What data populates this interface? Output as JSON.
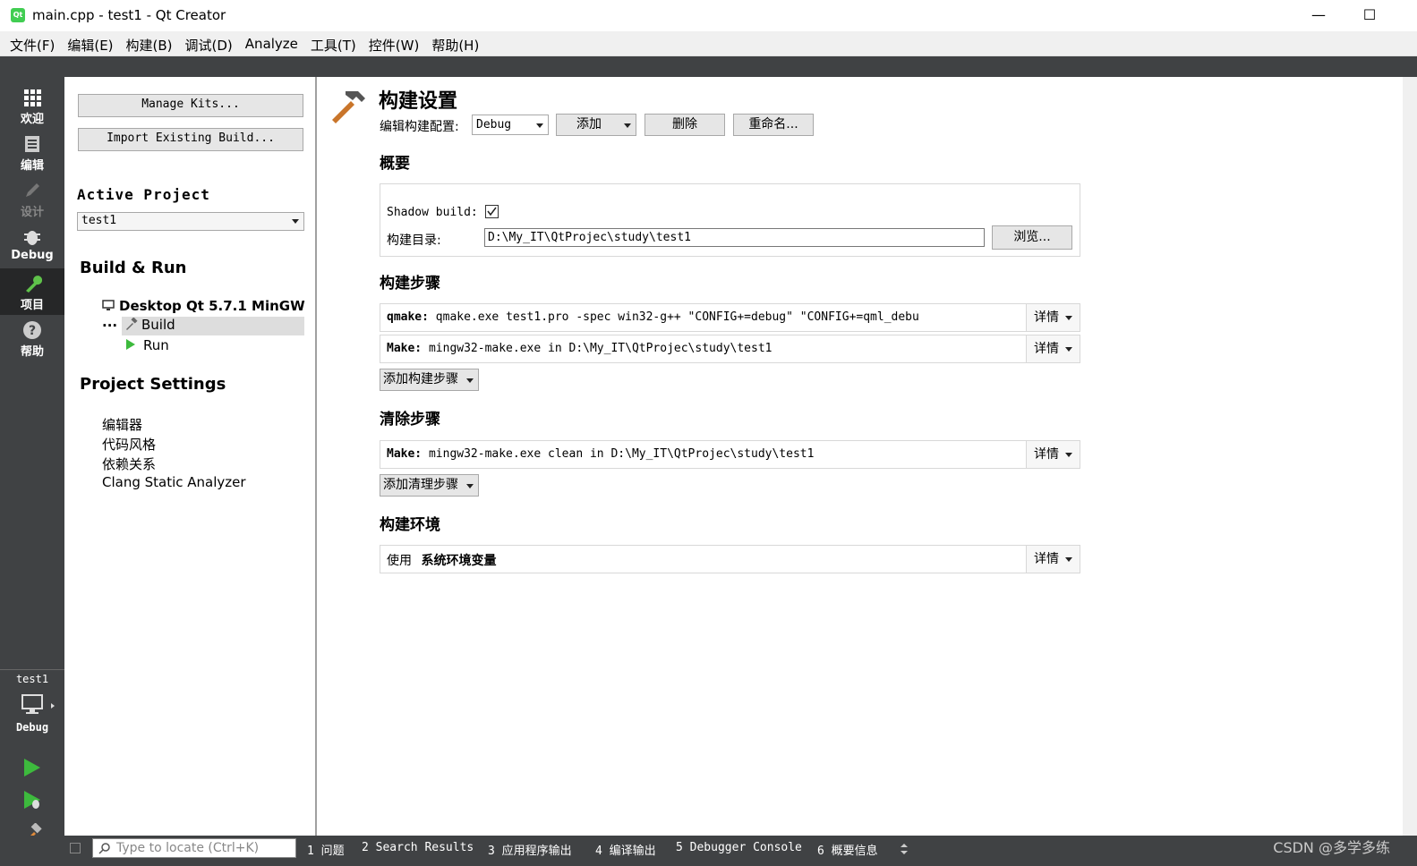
{
  "window": {
    "title": "main.cpp - test1 - Qt Creator",
    "app_icon_text": "Qt",
    "minimize_glyph": "—",
    "maximize_glyph": "☐"
  },
  "menu": [
    "文件(F)",
    "编辑(E)",
    "构建(B)",
    "调试(D)",
    "Analyze",
    "工具(T)",
    "控件(W)",
    "帮助(H)"
  ],
  "modes": {
    "welcome": "欢迎",
    "edit": "编辑",
    "design": "设计",
    "debug": "Debug",
    "projects": "项目",
    "help": "帮助"
  },
  "kit_selector": {
    "project": "test1",
    "config": "Debug"
  },
  "left_panel": {
    "manage_kits": "Manage Kits...",
    "import_build": "Import Existing Build...",
    "active_project_label": "Active Project",
    "active_project_value": "test1",
    "build_run_title": "Build & Run",
    "kit_name": "Desktop Qt 5.7.1 MinGW ...",
    "build_item": "Build",
    "run_item": "Run",
    "project_settings_title": "Project Settings",
    "settings_items": [
      "编辑器",
      "代码风格",
      "依赖关系",
      "Clang Static Analyzer"
    ]
  },
  "main": {
    "page_title": "构建设置",
    "edit_config_label": "编辑构建配置:",
    "config_value": "Debug",
    "add_button": "添加",
    "delete_button": "删除",
    "rename_button": "重命名...",
    "general_title": "概要",
    "shadow_build_label": "Shadow build:",
    "shadow_build_checked": true,
    "build_dir_label": "构建目录:",
    "build_dir_value": "D:\\My_IT\\QtProjec\\study\\test1",
    "browse_button": "浏览...",
    "build_steps_title": "构建步骤",
    "build_steps": [
      {
        "name": "qmake:",
        "cmd": "qmake.exe test1.pro -spec win32-g++ \"CONFIG+=debug\" \"CONFIG+=qml_debu",
        "details": "详情"
      },
      {
        "name": "Make:",
        "cmd": "mingw32-make.exe in D:\\My_IT\\QtProjec\\study\\test1",
        "details": "详情"
      }
    ],
    "add_build_step": "添加构建步骤",
    "clean_steps_title": "清除步骤",
    "clean_steps": [
      {
        "name": "Make:",
        "cmd": "mingw32-make.exe clean in D:\\My_IT\\QtProjec\\study\\test1",
        "details": "详情"
      }
    ],
    "add_clean_step": "添加清理步骤",
    "build_env_title": "构建环境",
    "env_prefix": "使用",
    "env_value": "系统环境变量",
    "env_details": "详情"
  },
  "status": {
    "locator_placeholder": "Type to locate (Ctrl+K)",
    "panes": [
      "1 问题",
      "2 Search Results",
      "3 应用程序输出",
      "4 编译输出",
      "5 Debugger Console",
      "6 概要信息"
    ],
    "watermark": "CSDN @多学多练"
  },
  "colors": {
    "sidebar": "#404244",
    "sidebar_active": "#262728",
    "run_green": "#3dba3d"
  }
}
